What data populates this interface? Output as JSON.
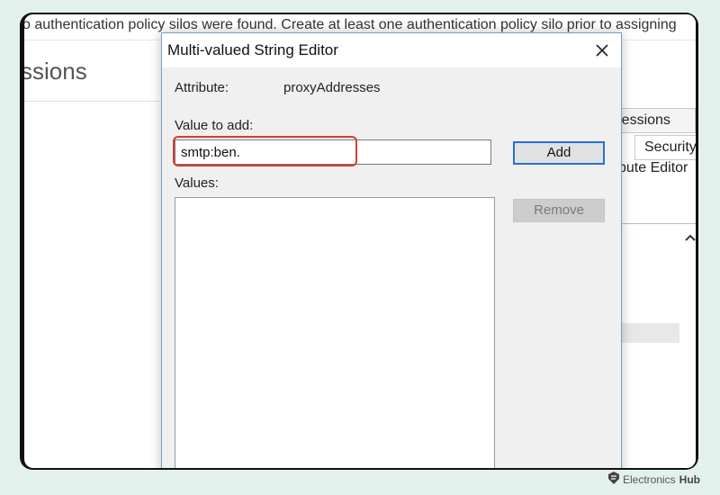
{
  "background": {
    "info_bar_text": "o authentication policy silos were found. Create at least one authentication policy silo prior to assigning",
    "heading_fragment": "ssions",
    "tab_sessions": "Sessions",
    "tab_security": "Security",
    "attribute_editor_fragment": "bute Editor"
  },
  "dialog": {
    "title": "Multi-valued String Editor",
    "close_icon": "close-icon",
    "attribute_label": "Attribute:",
    "attribute_value": "proxyAddresses",
    "value_to_add_label": "Value to add:",
    "value_input": "smtp:ben.",
    "add_label": "Add",
    "values_label": "Values:",
    "values": [],
    "remove_label": "Remove",
    "highlight_color": "#d83a3a",
    "default_button_border": "#2a6fd2"
  },
  "watermark": {
    "brand_part1": "Electronics",
    "brand_part2": "Hub"
  }
}
